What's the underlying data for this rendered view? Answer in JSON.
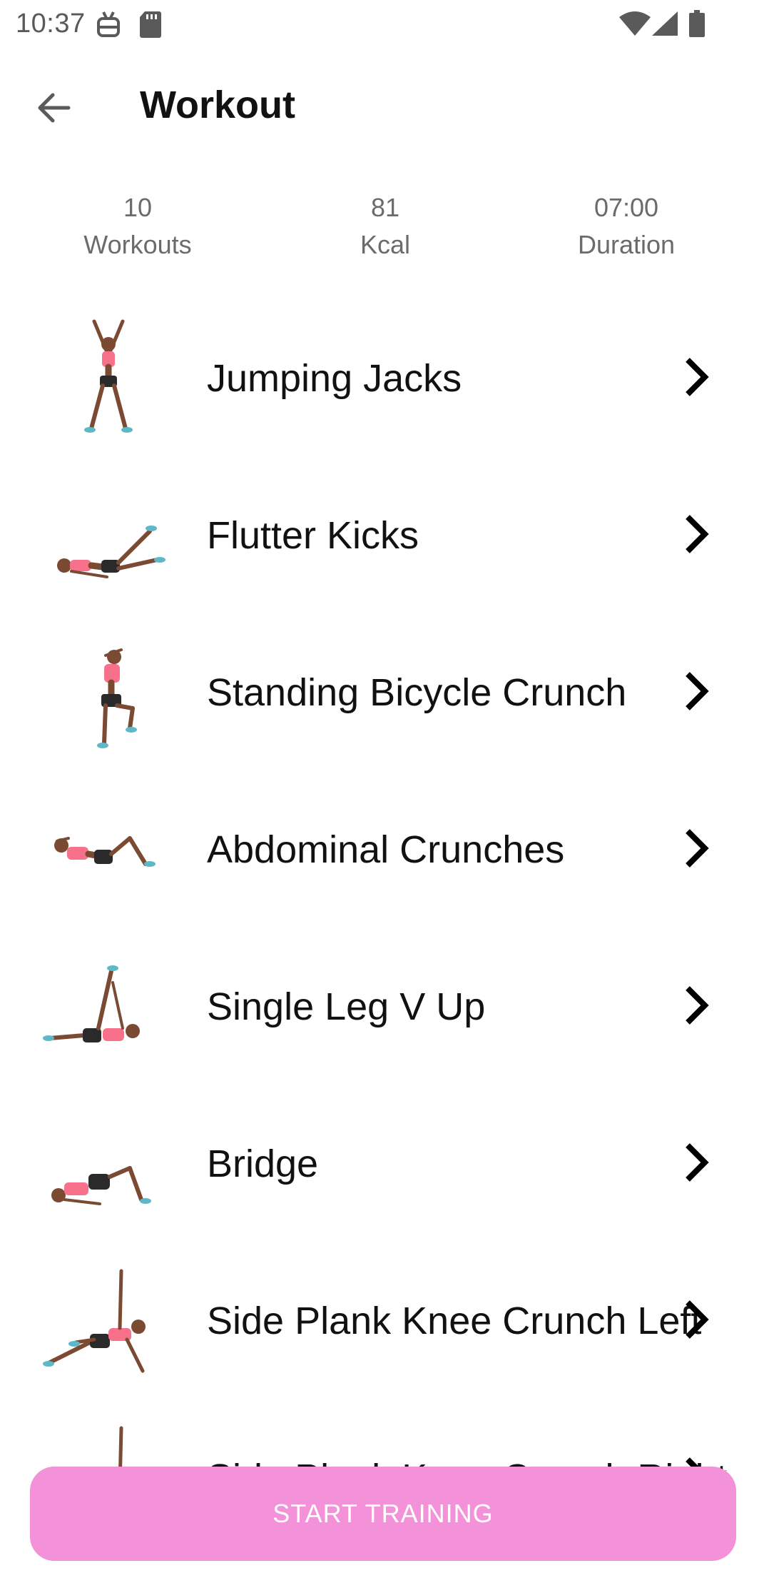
{
  "status_bar": {
    "time": "10:37",
    "icons": [
      "android-debug-icon",
      "sd-card-icon",
      "wifi-icon",
      "cell-signal-icon",
      "battery-icon"
    ]
  },
  "app_bar": {
    "back_icon": "arrow-left-icon",
    "title": "Workout"
  },
  "stats": [
    {
      "value": "10",
      "label": "Workouts"
    },
    {
      "value": "81",
      "label": "Kcal"
    },
    {
      "value": "07:00",
      "label": "Duration"
    }
  ],
  "exercises": [
    {
      "name": "Jumping Jacks",
      "pose": "jumping-jacks"
    },
    {
      "name": "Flutter Kicks",
      "pose": "flutter-kicks"
    },
    {
      "name": "Standing Bicycle Crunch",
      "pose": "standing-bicycle-crunch"
    },
    {
      "name": "Abdominal Crunches",
      "pose": "abdominal-crunches"
    },
    {
      "name": "Single Leg V Up",
      "pose": "single-leg-v-up"
    },
    {
      "name": "Bridge",
      "pose": "bridge"
    },
    {
      "name": "Side Plank Knee Crunch Left",
      "pose": "side-plank"
    },
    {
      "name": "Side Plank Knee Crunch Right",
      "pose": "side-plank"
    }
  ],
  "colors": {
    "accent": "#f391d9",
    "skin": "#7a4a33",
    "top": "#f7718a",
    "shorts": "#2a2a2a",
    "shoes": "#5fb8c8"
  },
  "start_button": {
    "label": "START TRAINING"
  }
}
